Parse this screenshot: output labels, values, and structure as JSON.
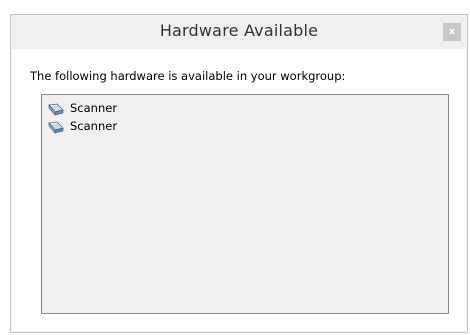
{
  "window": {
    "title": "Hardware Available",
    "close_label": "x"
  },
  "description": "The following hardware is available in your workgroup:",
  "hardware_list": {
    "items": [
      {
        "label": "Scanner",
        "icon": "scanner-icon"
      },
      {
        "label": "Scanner",
        "icon": "scanner-icon"
      }
    ]
  },
  "colors": {
    "title_bar": "#f0f0f0",
    "close_button": "#c7c7c7",
    "list_background": "#f0f0f0"
  }
}
